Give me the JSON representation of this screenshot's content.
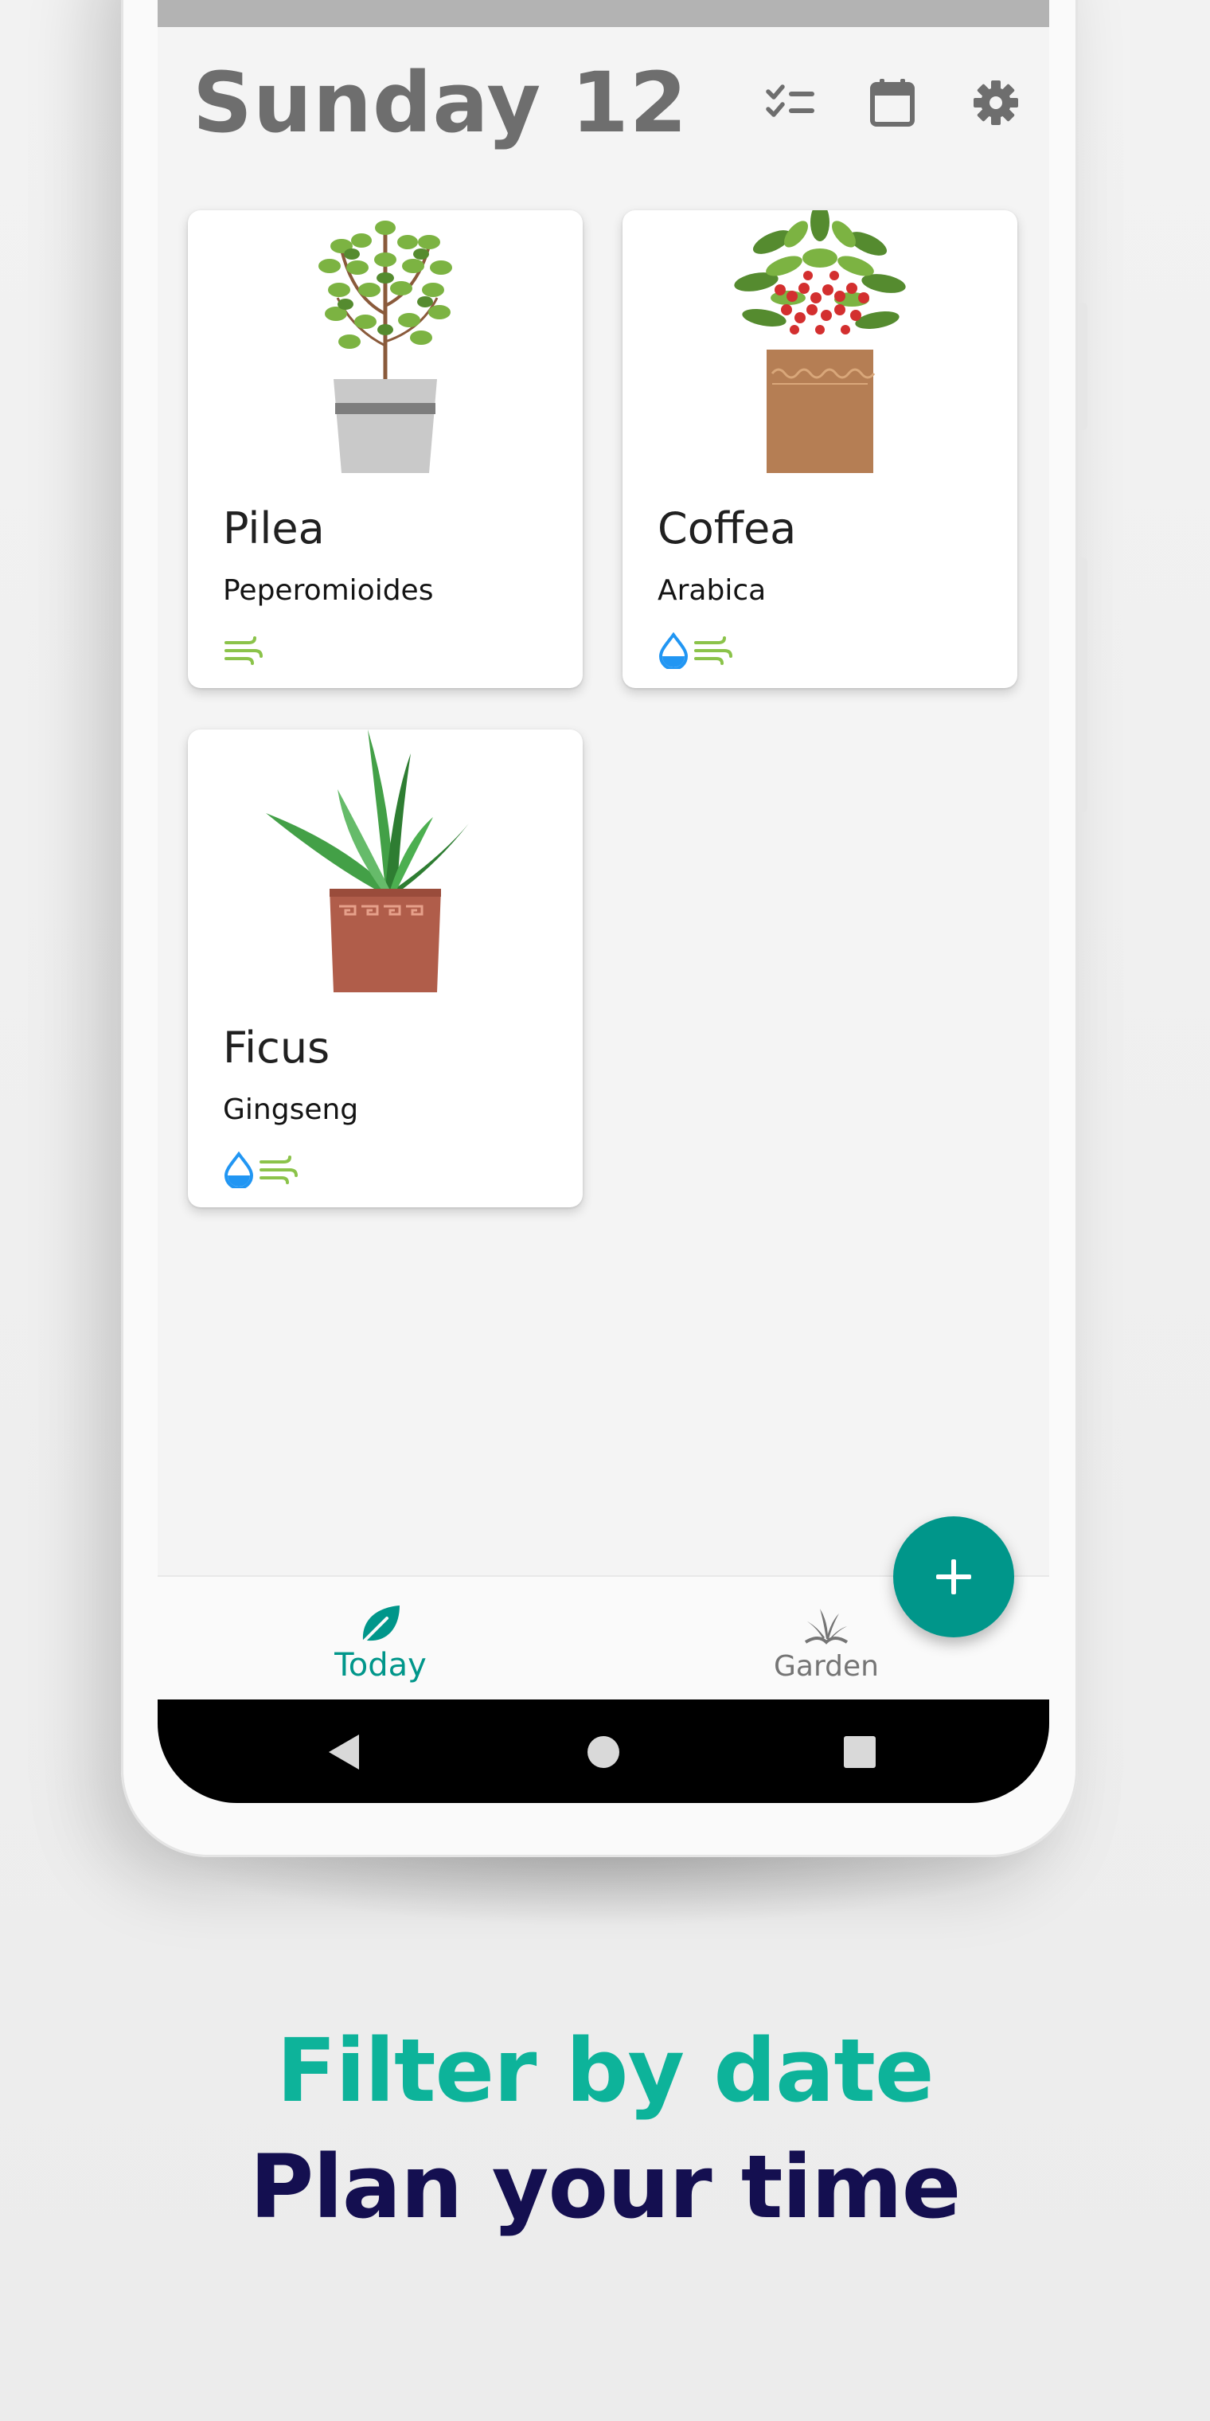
{
  "app": {
    "title": "Sunday 12",
    "toolbar": {
      "tasks_icon": "checklist-icon",
      "calendar_icon": "calendar-icon",
      "settings_icon": "gear-icon"
    }
  },
  "plants": [
    {
      "name": "Pilea",
      "species": "Peperomioides",
      "needs": [
        "wind-icon"
      ],
      "image": "pilea-plant-illustration"
    },
    {
      "name": "Coffea",
      "species": "Arabica",
      "needs": [
        "water-drop-icon",
        "wind-icon"
      ],
      "image": "coffea-plant-illustration"
    },
    {
      "name": "Ficus",
      "species": "Gingseng",
      "needs": [
        "water-drop-icon",
        "wind-icon"
      ],
      "image": "ficus-plant-illustration"
    }
  ],
  "fab": {
    "icon": "plus-icon"
  },
  "bottom_nav": {
    "items": [
      {
        "label": "Today",
        "icon": "leaf-icon",
        "active": true
      },
      {
        "label": "Garden",
        "icon": "grass-icon",
        "active": false
      }
    ]
  },
  "system_nav": {
    "back_icon": "back-triangle-icon",
    "home_icon": "home-circle-icon",
    "recents_icon": "recents-square-icon"
  },
  "promo": {
    "line1": "Filter by date",
    "line2": "Plan your time"
  },
  "colors": {
    "accent": "#00968a",
    "headline_teal": "#0db39a",
    "headline_navy": "#140f50",
    "water": "#2196f3",
    "wind": "#8bc34a",
    "title_gray": "#6e6e6e"
  }
}
